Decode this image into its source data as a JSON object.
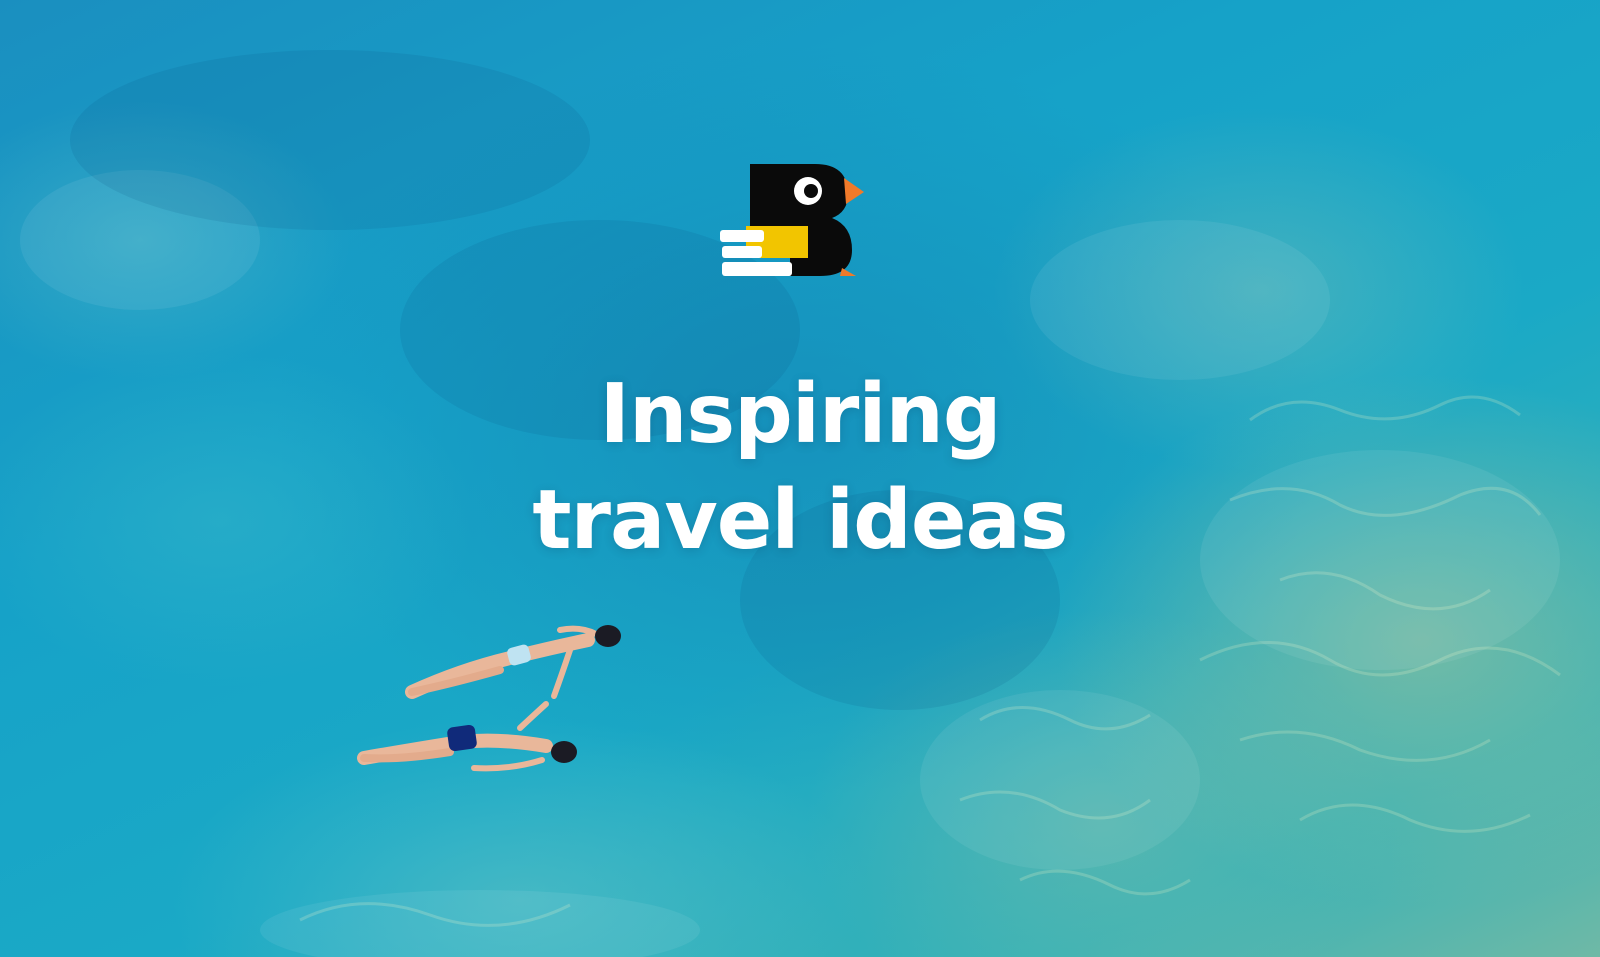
{
  "brand": {
    "logo_icon": "bird-b-logo-icon",
    "colors": {
      "logo_black": "#0a0a0a",
      "logo_yellow": "#f2c500",
      "logo_orange": "#f07a2a",
      "logo_white": "#ffffff",
      "water": "#1aa9c6"
    }
  },
  "hero": {
    "headline_line1": "Inspiring",
    "headline_line2": "travel ideas"
  }
}
